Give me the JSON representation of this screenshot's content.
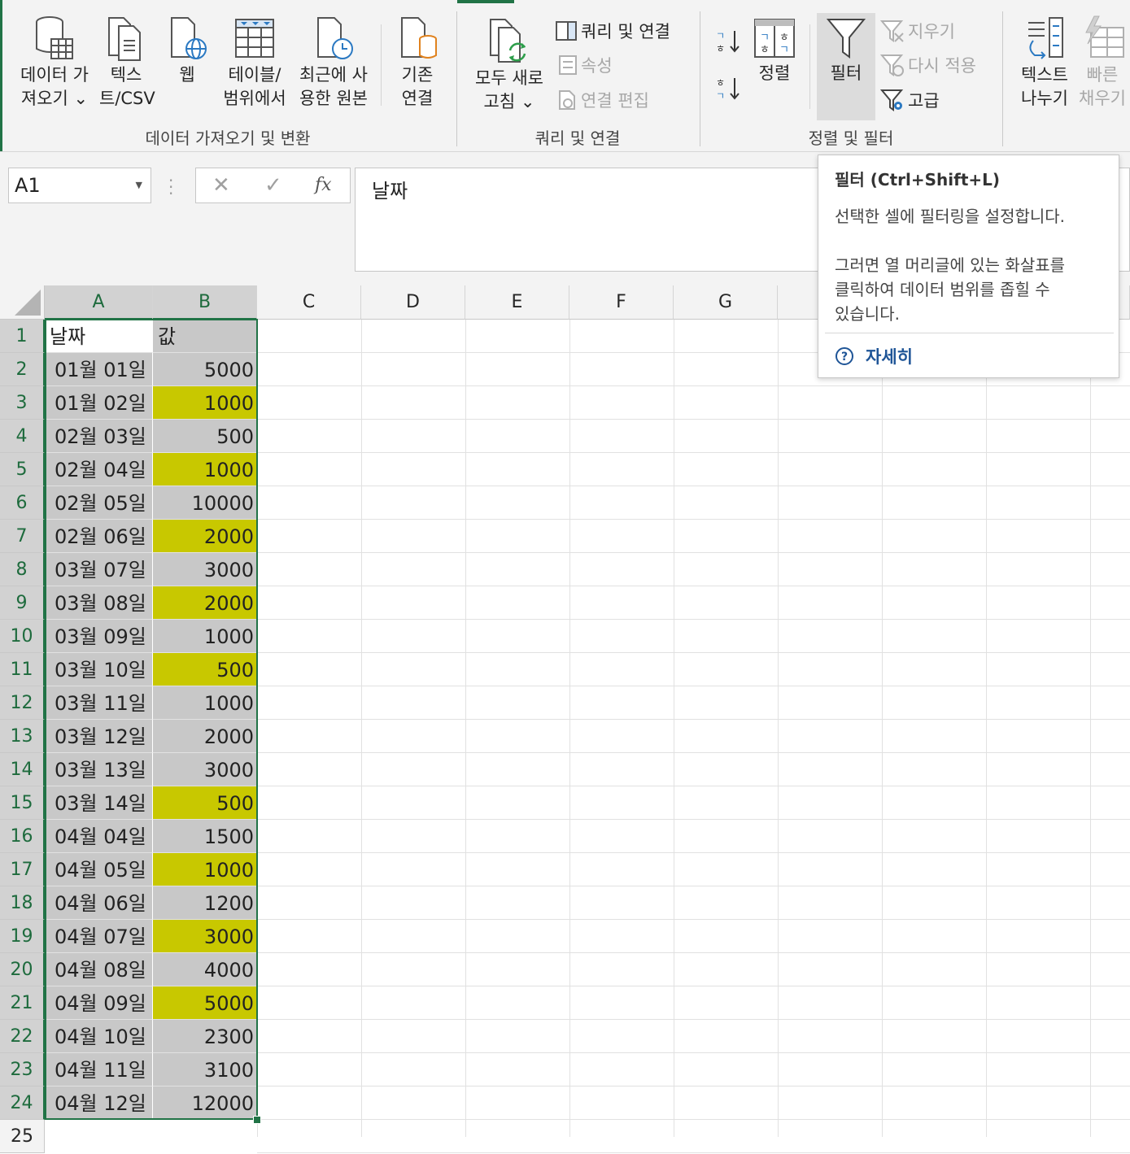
{
  "ribbon": {
    "get_data_label_1": "데이터 가",
    "get_data_label_2": "져오기 ⌄",
    "text_csv_label_1": "텍스",
    "text_csv_label_2": "트/CSV",
    "web_label": "웹",
    "table_range_label_1": "테이블/",
    "table_range_label_2": "범위에서",
    "recent_sources_label_1": "최근에 사",
    "recent_sources_label_2": "용한 원본",
    "existing_conn_label_1": "기존",
    "existing_conn_label_2": "연결",
    "group_get_transform": "데이터 가져오기 및 변환",
    "refresh_all_label_1": "모두 새로",
    "refresh_all_label_2": "고침 ⌄",
    "queries_connections": "쿼리 및 연결",
    "properties": "속성",
    "edit_links": "연결 편집",
    "group_queries": "쿼리 및 연결",
    "sort_label": "정렬",
    "filter_label": "필터",
    "clear_label": "지우기",
    "reapply_label": "다시 적용",
    "advanced_label": "고급",
    "group_sort_filter": "정렬 및 필터",
    "text_to_columns_label_1": "텍스트",
    "text_to_columns_label_2": "나누기",
    "flash_fill_label_1": "빠른",
    "flash_fill_label_2": "채우기"
  },
  "formula_bar": {
    "name_box": "A1",
    "cancel_glyph": "✕",
    "enter_glyph": "✓",
    "fx_glyph": "fx",
    "content": "날짜"
  },
  "columns": [
    "A",
    "B",
    "C",
    "D",
    "E",
    "F",
    "G"
  ],
  "rows": [
    {
      "num": "1",
      "a": "날짜",
      "b": "값",
      "hl": false,
      "header": true
    },
    {
      "num": "2",
      "a": "01월 01일",
      "b": "5000",
      "hl": false
    },
    {
      "num": "3",
      "a": "01월 02일",
      "b": "1000",
      "hl": true
    },
    {
      "num": "4",
      "a": "02월 03일",
      "b": "500",
      "hl": false
    },
    {
      "num": "5",
      "a": "02월 04일",
      "b": "1000",
      "hl": true
    },
    {
      "num": "6",
      "a": "02월 05일",
      "b": "10000",
      "hl": false
    },
    {
      "num": "7",
      "a": "02월 06일",
      "b": "2000",
      "hl": true
    },
    {
      "num": "8",
      "a": "03월 07일",
      "b": "3000",
      "hl": false
    },
    {
      "num": "9",
      "a": "03월 08일",
      "b": "2000",
      "hl": true
    },
    {
      "num": "10",
      "a": "03월 09일",
      "b": "1000",
      "hl": false
    },
    {
      "num": "11",
      "a": "03월 10일",
      "b": "500",
      "hl": true
    },
    {
      "num": "12",
      "a": "03월 11일",
      "b": "1000",
      "hl": false
    },
    {
      "num": "13",
      "a": "03월 12일",
      "b": "2000",
      "hl": false
    },
    {
      "num": "14",
      "a": "03월 13일",
      "b": "3000",
      "hl": false
    },
    {
      "num": "15",
      "a": "03월 14일",
      "b": "500",
      "hl": true
    },
    {
      "num": "16",
      "a": "04월 04일",
      "b": "1500",
      "hl": false
    },
    {
      "num": "17",
      "a": "04월 05일",
      "b": "1000",
      "hl": true
    },
    {
      "num": "18",
      "a": "04월 06일",
      "b": "1200",
      "hl": false
    },
    {
      "num": "19",
      "a": "04월 07일",
      "b": "3000",
      "hl": true
    },
    {
      "num": "20",
      "a": "04월 08일",
      "b": "4000",
      "hl": false
    },
    {
      "num": "21",
      "a": "04월 09일",
      "b": "5000",
      "hl": true
    },
    {
      "num": "22",
      "a": "04월 10일",
      "b": "2300",
      "hl": false
    },
    {
      "num": "23",
      "a": "04월 11일",
      "b": "3100",
      "hl": false
    },
    {
      "num": "24",
      "a": "04월 12일",
      "b": "12000",
      "hl": false
    },
    {
      "num": "25",
      "a": "",
      "b": "",
      "hl": false,
      "empty": true
    }
  ],
  "tooltip": {
    "title": "필터 (Ctrl+Shift+L)",
    "line1": "선택한 셀에 필터링을 설정합니다.",
    "line2": "그러면 열 머리글에 있는 화살표를",
    "line3": "클릭하여 데이터 범위를 좁힐 수",
    "line4": "있습니다.",
    "more": "자세히"
  },
  "colors": {
    "accent": "#217346",
    "selected_fill": "#c8c8c8",
    "highlight_fill": "#c8c800",
    "link": "#1f5597"
  }
}
